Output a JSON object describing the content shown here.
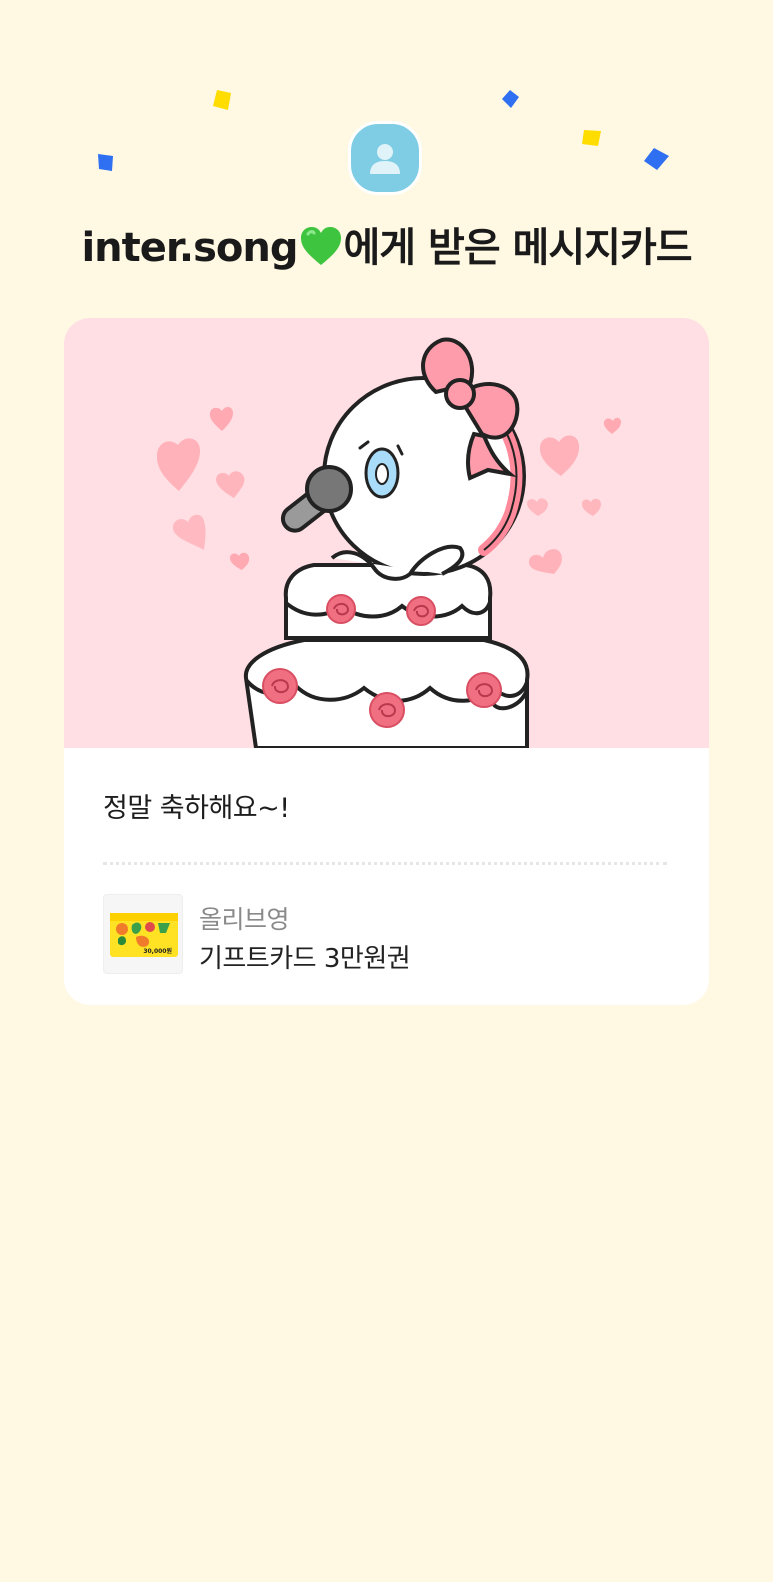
{
  "colors": {
    "background": "#fff8e2",
    "avatar": "#7fcde4",
    "illustration_background": "#ffdfe4",
    "confetti_yellow": "#ffdd00",
    "confetti_blue": "#2f6ff2",
    "heart_green": "#3ec43e"
  },
  "header": {
    "sender": "inter.song",
    "heart_emoji": "💚",
    "suffix": "에게 받은 메시지카드",
    "avatar_icon": "person-icon"
  },
  "card": {
    "illustration": "character-singing-on-cake-illustration",
    "message": "정말 축하해요~!",
    "gift": {
      "brand": "올리브영",
      "name": "기프트카드 3만원권",
      "thumbnail_amount": "30,000원"
    }
  }
}
